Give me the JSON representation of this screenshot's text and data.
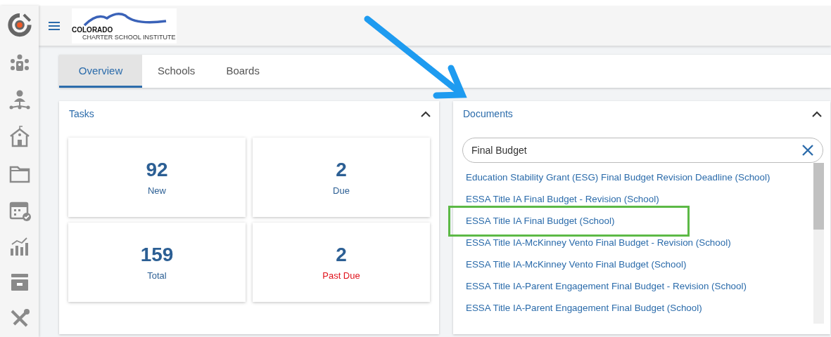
{
  "header": {
    "logo_line1": "COLORADO",
    "logo_line2": "CHARTER SCHOOL INSTITUTE"
  },
  "tabs": [
    {
      "label": "Overview",
      "selected": true
    },
    {
      "label": "Schools",
      "selected": false
    },
    {
      "label": "Boards",
      "selected": false
    }
  ],
  "tasks": {
    "title": "Tasks",
    "expanded": true,
    "tiles": [
      {
        "count": "92",
        "label": "New",
        "alert": false
      },
      {
        "count": "2",
        "label": "Due",
        "alert": false
      },
      {
        "count": "159",
        "label": "Total",
        "alert": false
      },
      {
        "count": "2",
        "label": "Past Due",
        "alert": true
      }
    ]
  },
  "documents": {
    "title": "Documents",
    "expanded": true,
    "search": {
      "value": "Final Budget"
    },
    "items": [
      {
        "label": "Education Stability Grant (ESG) Final Budget Revision Deadline (School)",
        "highlighted": false
      },
      {
        "label": "ESSA Title IA Final Budget - Revision (School)",
        "highlighted": false
      },
      {
        "label": "ESSA Title IA Final Budget (School)",
        "highlighted": true
      },
      {
        "label": "ESSA Title IA-McKinney Vento Final Budget - Revision (School)",
        "highlighted": false
      },
      {
        "label": "ESSA Title IA-McKinney Vento Final Budget (School)",
        "highlighted": false
      },
      {
        "label": "ESSA Title IA-Parent Engagement Final Budget - Revision (School)",
        "highlighted": false
      },
      {
        "label": "ESSA Title IA-Parent Engagement Final Budget (School)",
        "highlighted": false
      }
    ]
  }
}
